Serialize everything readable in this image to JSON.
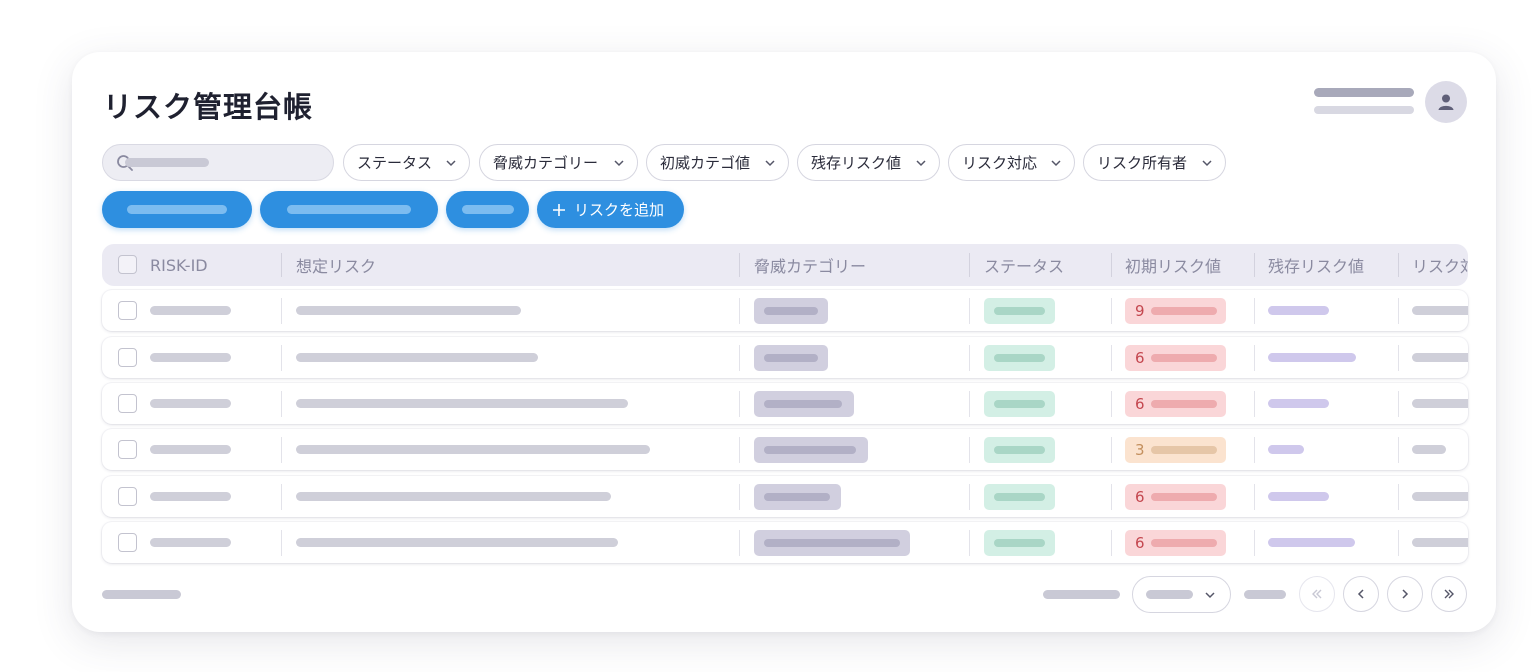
{
  "page": {
    "title": "リスク管理台帳"
  },
  "filters": [
    {
      "label": "ステータス"
    },
    {
      "label": "脅威カテゴリー"
    },
    {
      "label": "初威カテゴ値"
    },
    {
      "label": "残存リスク値"
    },
    {
      "label": "リスク対応"
    },
    {
      "label": "リスク所有者"
    }
  ],
  "actions": {
    "add_risk_label": "リスクを追加",
    "add_icon": "plus-icon"
  },
  "table": {
    "columns": [
      "RISK-ID",
      "想定リスク",
      "脅威カテゴリー",
      "ステータス",
      "初期リスク値",
      "残存リスク値",
      "リスク対"
    ],
    "rows": [
      {
        "initial_risk": "9",
        "level": "high"
      },
      {
        "initial_risk": "6",
        "level": "high"
      },
      {
        "initial_risk": "6",
        "level": "high"
      },
      {
        "initial_risk": "3",
        "level": "medium"
      },
      {
        "initial_risk": "6",
        "level": "high"
      },
      {
        "initial_risk": "6",
        "level": "high"
      }
    ]
  },
  "icons": {
    "search": "search-icon",
    "user": "user-icon",
    "chevron": "chevron-down-icon"
  },
  "colors": {
    "primary": "#2e8fe0",
    "high_bg": "#fad6d8",
    "high_text": "#c4474f",
    "medium_bg": "#fbe3cf",
    "medium_text": "#c4905e",
    "status_bg": "#d3efe5",
    "category_bg": "#d1cfdf",
    "residual_bar": "#cfc8ec"
  }
}
